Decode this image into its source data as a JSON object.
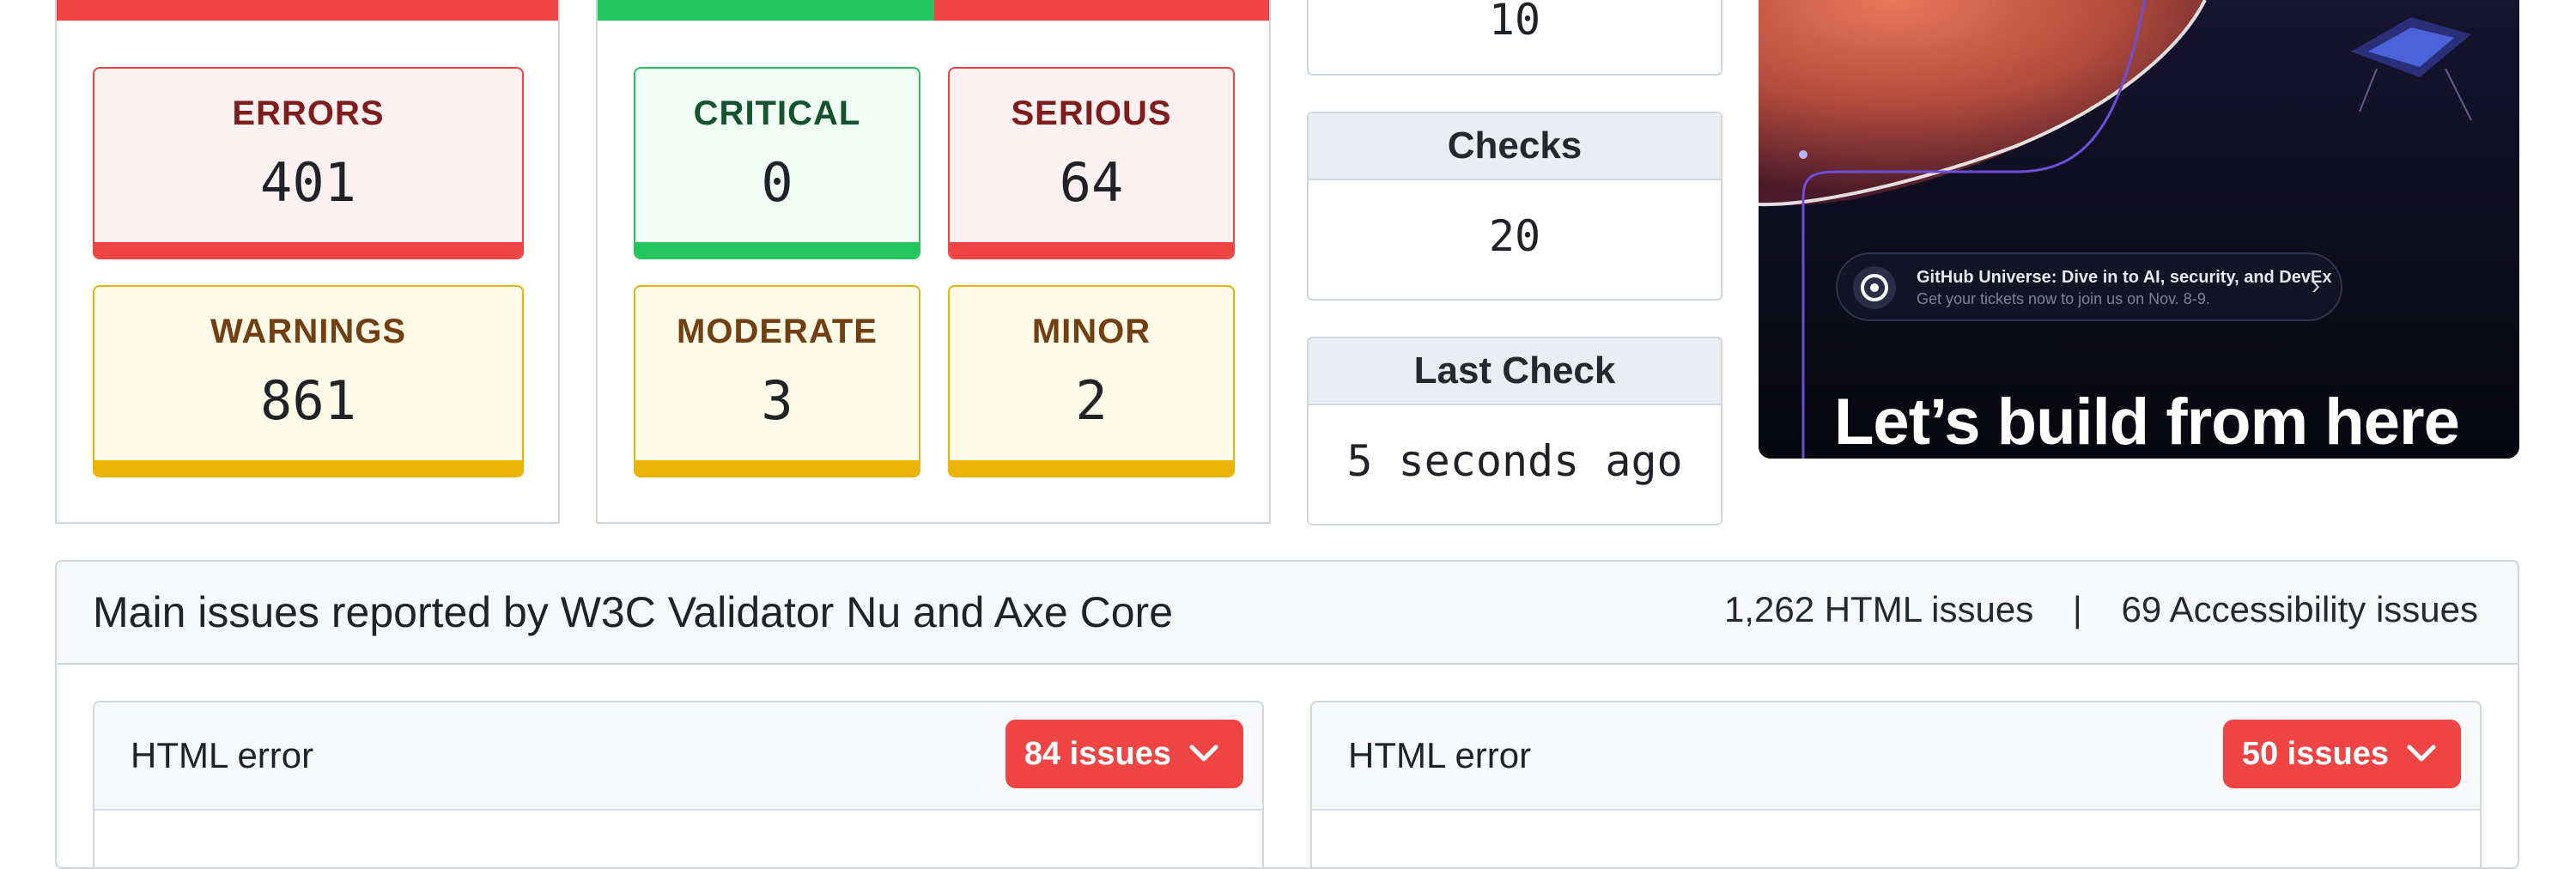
{
  "summary": {
    "errors": {
      "label": "ERRORS",
      "value": "401"
    },
    "warnings": {
      "label": "WARNINGS",
      "value": "861"
    }
  },
  "accessibility": {
    "critical": {
      "label": "CRITICAL",
      "value": "0"
    },
    "serious": {
      "label": "SERIOUS",
      "value": "64"
    },
    "moderate": {
      "label": "MODERATE",
      "value": "3"
    },
    "minor": {
      "label": "MINOR",
      "value": "2"
    }
  },
  "info": {
    "top_value": "10",
    "checks": {
      "label": "Checks",
      "value": "20"
    },
    "last_check": {
      "label": "Last Check",
      "value": "5 seconds ago"
    }
  },
  "promo": {
    "pill_title": "GitHub Universe: Dive in to AI, security, and DevEx",
    "pill_subtitle": "Get your tickets now to join us on Nov. 8-9.",
    "headline": "Let’s build from here"
  },
  "main": {
    "title": "Main issues reported by W3C Validator Nu and Axe Core",
    "html_issues": "1,262 HTML issues",
    "separator": "|",
    "a11y_issues": "69 Accessibility issues",
    "cards": [
      {
        "title": "HTML error",
        "badge": "84 issues"
      },
      {
        "title": "HTML error",
        "badge": "50 issues"
      }
    ]
  },
  "colors": {
    "error": "#ef4444",
    "success": "#22c55e",
    "warning": "#eab308",
    "border": "#d0d7de"
  }
}
